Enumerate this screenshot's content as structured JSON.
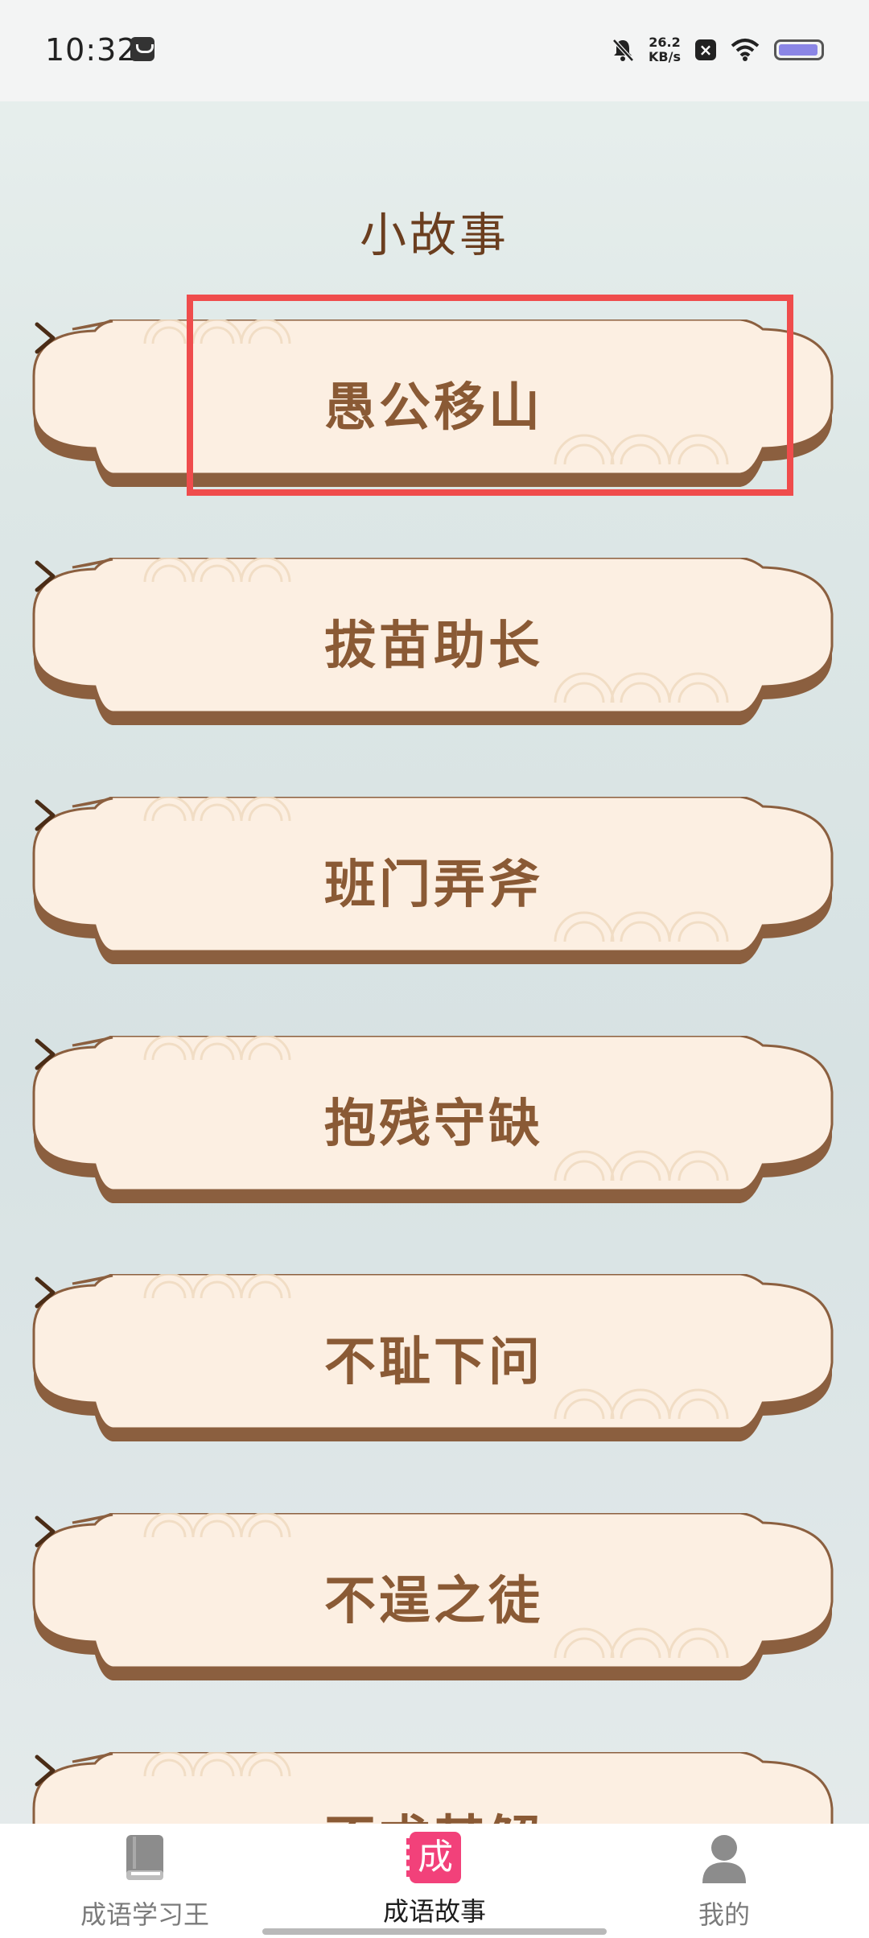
{
  "status_bar": {
    "time": "10:32",
    "net_speed_value": "26.2",
    "net_speed_unit": "KB/s"
  },
  "page": {
    "title": "小故事"
  },
  "stories": [
    {
      "label": "愚公移山"
    },
    {
      "label": "拔苗助长"
    },
    {
      "label": "班门弄斧"
    },
    {
      "label": "抱残守缺"
    },
    {
      "label": "不耻下问"
    },
    {
      "label": "不逞之徒"
    },
    {
      "label": "不求甚解"
    }
  ],
  "bottom_nav": {
    "items": [
      {
        "label": "成语学习王",
        "icon": "book-icon"
      },
      {
        "label": "成语故事",
        "icon": "cheng-badge-icon",
        "badge_char": "成",
        "active": true
      },
      {
        "label": "我的",
        "icon": "person-icon"
      }
    ]
  },
  "colors": {
    "card_fill": "#fcefe2",
    "card_border": "#8b5f3f",
    "text_brown": "#8a5a35",
    "highlight": "#ef4c4c",
    "badge_pink": "#f2417a"
  }
}
